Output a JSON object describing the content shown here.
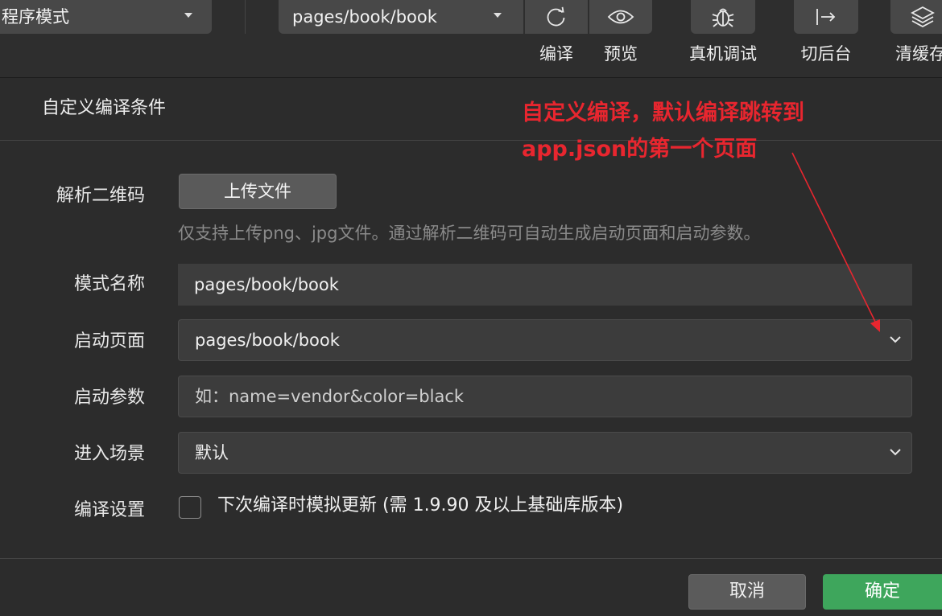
{
  "toolbar": {
    "mode_select_value": "程序模式",
    "page_select_value": "pages/book/book",
    "compile_label": "编译",
    "preview_label": "预览",
    "debug_label": "真机调试",
    "backend_label": "切后台",
    "cache_label": "清缓存"
  },
  "dialog": {
    "title": "自定义编译条件",
    "qr_label": "解析二维码",
    "upload_button": "上传文件",
    "upload_hint": "仅支持上传png、jpg文件。通过解析二维码可自动生成启动页面和启动参数。",
    "mode_name_label": "模式名称",
    "mode_name_value": "pages/book/book",
    "start_page_label": "启动页面",
    "start_page_value": "pages/book/book",
    "start_params_label": "启动参数",
    "start_params_placeholder": "如：name=vendor&color=black",
    "scene_label": "进入场景",
    "scene_value": "默认",
    "compile_settings_label": "编译设置",
    "simulate_update_label": "下次编译时模拟更新 (需 1.9.90 及以上基础库版本)",
    "simulate_update_checked": false,
    "cancel_button": "取消",
    "confirm_button": "确定"
  },
  "annotation": {
    "line1": "自定义编译，默认编译跳转到",
    "line2": "app.json的第一个页面",
    "color": "#e8262f"
  },
  "colors": {
    "background": "#2c2c2c",
    "field": "#3c3c3c",
    "confirm": "#3ea65c"
  }
}
